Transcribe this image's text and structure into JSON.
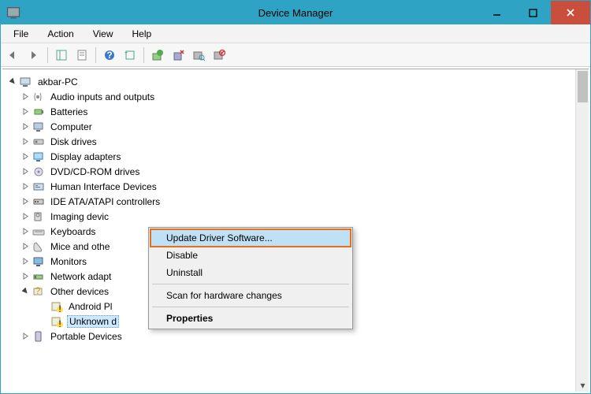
{
  "window": {
    "title": "Device Manager"
  },
  "menubar": {
    "file": "File",
    "action": "Action",
    "view": "View",
    "help": "Help"
  },
  "tree": {
    "root": "akbar-PC",
    "items": [
      "Audio inputs and outputs",
      "Batteries",
      "Computer",
      "Disk drives",
      "Display adapters",
      "DVD/CD-ROM drives",
      "Human Interface Devices",
      "IDE ATA/ATAPI controllers",
      "Imaging devic",
      "Keyboards",
      "Mice and othe",
      "Monitors",
      "Network adapt"
    ],
    "other_devices": {
      "label": "Other devices",
      "children": [
        "Android Pl",
        "Unknown d"
      ]
    },
    "portable": "Portable Devices"
  },
  "context_menu": {
    "update": "Update Driver Software...",
    "disable": "Disable",
    "uninstall": "Uninstall",
    "scan": "Scan for hardware changes",
    "properties": "Properties"
  },
  "icons": {
    "back": "back-icon",
    "forward": "forward-icon",
    "show_hidden": "show-hidden-icon",
    "properties": "properties-icon",
    "help": "help-icon",
    "refresh": "refresh-icon",
    "update": "update-driver-icon",
    "uninstall": "uninstall-icon",
    "scan": "scan-icon",
    "disable": "disable-icon"
  }
}
